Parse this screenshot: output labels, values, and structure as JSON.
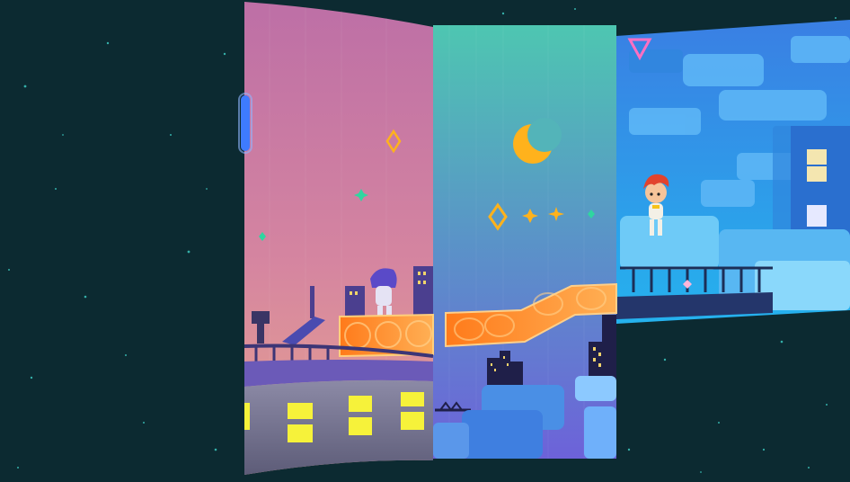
{
  "scene": {
    "title": "",
    "panels": [
      {
        "name": "sunset-rooftop-panel",
        "sky_top": "#bd6fa6",
        "sky_bottom": "#e49a8e"
      },
      {
        "name": "teal-night-panel",
        "sky_top": "#4fbfb0",
        "sky_bottom": "#6f67d8"
      },
      {
        "name": "blue-ruins-panel",
        "sky_top": "#3f8fe8",
        "sky_bottom": "#2ab3f0"
      }
    ],
    "colors": {
      "space": "#0c2a31",
      "star": "#3fd1c7",
      "platform": "#ff8a2a",
      "window_glow": "#f6f23a",
      "moon": "#ffb21c"
    }
  }
}
